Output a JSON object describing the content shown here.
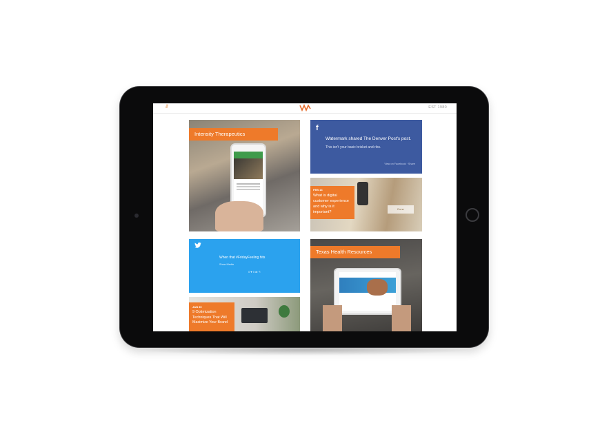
{
  "header": {
    "left_logo_text": "///",
    "est_text": "EST 1980"
  },
  "cards": {
    "intensity": {
      "tag": "Intensity Therapeutics"
    },
    "facebook": {
      "icon": "f",
      "headline": "Watermark shared The Denver Post's post.",
      "sub": "This isn't your basic brisket and ribs.",
      "footer": "View on Facebook · Share"
    },
    "feb_post": {
      "date": "FEB 14",
      "title": "What is digital customer experience and why is it important?",
      "cta": "Done"
    },
    "twitter": {
      "headline": "When that #FridayFeeling hits",
      "sub": "Show Media",
      "stats": "0 ♥   0 ⇄   ↰"
    },
    "jan_post": {
      "date": "JAN 30",
      "title": "9 Optimization Techniques That Will Maximize Your Brand"
    },
    "texas": {
      "tag": "Texas Health Resources"
    }
  }
}
